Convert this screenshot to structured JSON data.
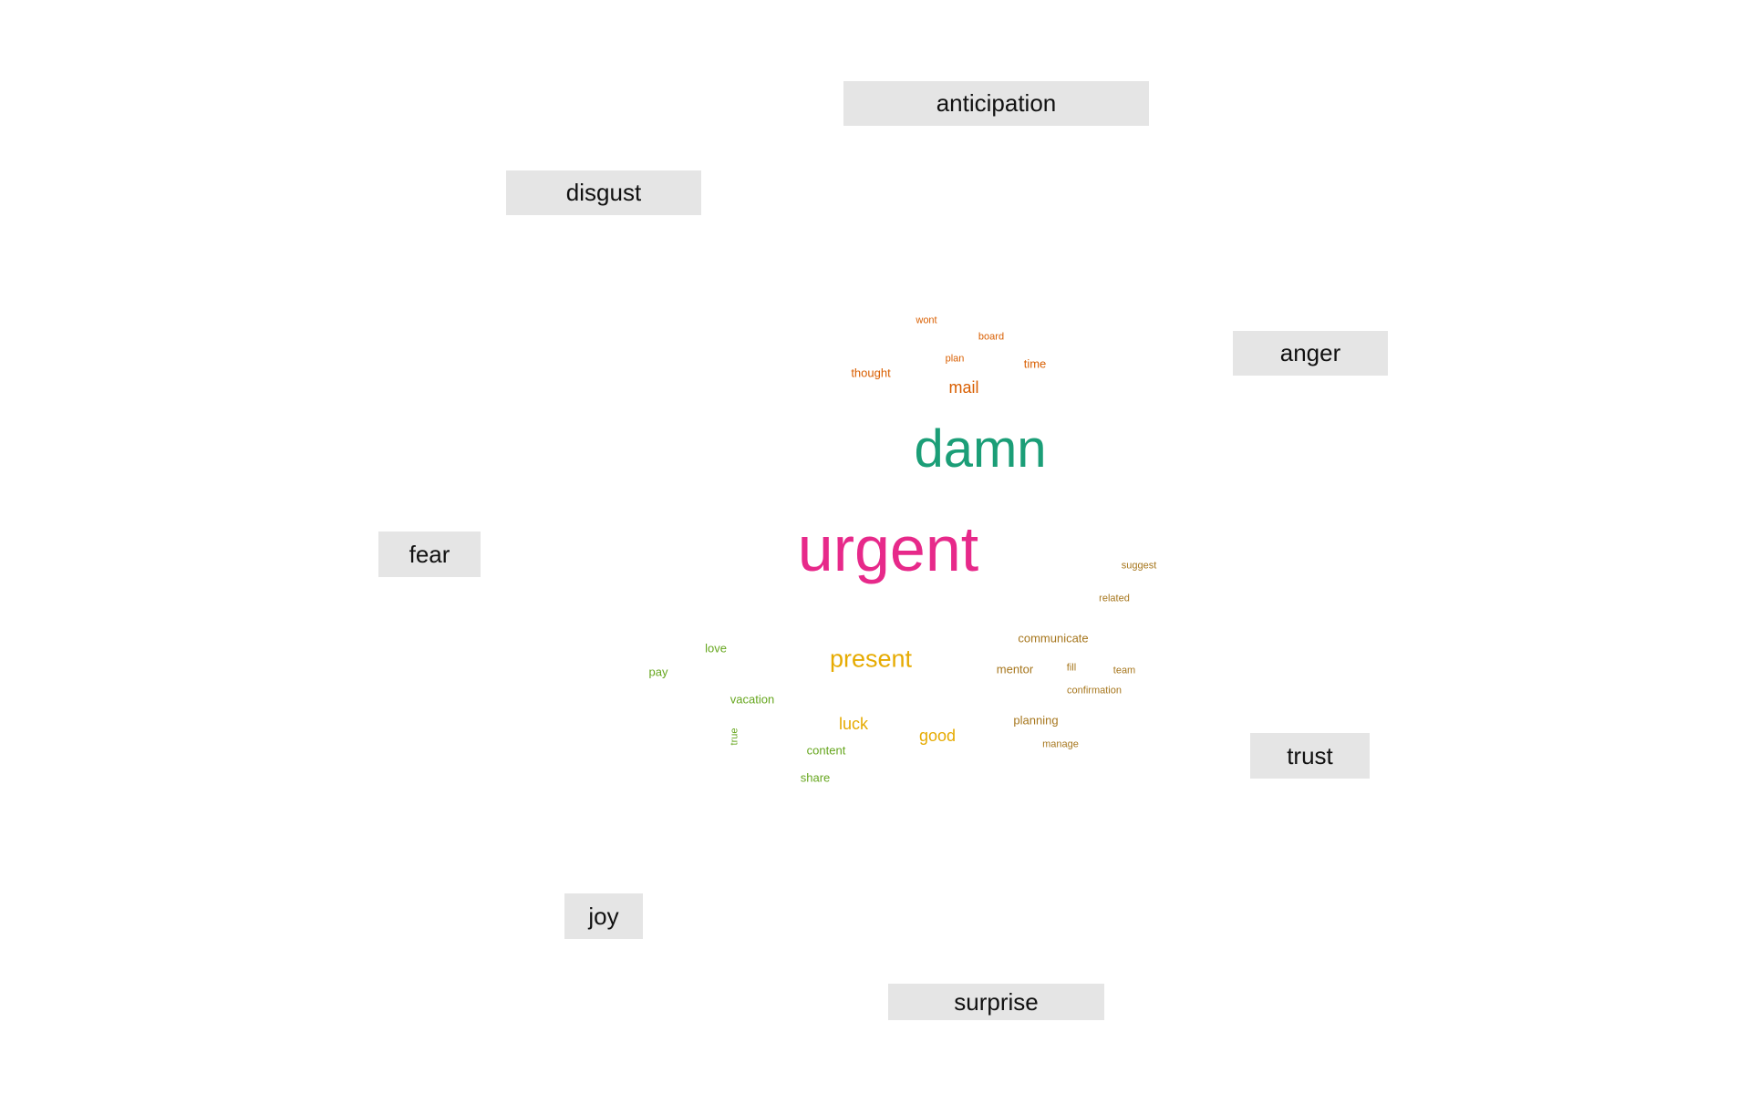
{
  "chart_data": {
    "type": "comparison-wordcloud",
    "categories": [
      "anticipation",
      "disgust",
      "anger",
      "fear",
      "trust",
      "joy",
      "surprise"
    ],
    "groups": [
      {
        "category": "anger",
        "color": "#d95f02",
        "words": [
          {
            "text": "wont",
            "weight": 1
          },
          {
            "text": "board",
            "weight": 1
          },
          {
            "text": "plan",
            "weight": 1
          },
          {
            "text": "thought",
            "weight": 2
          },
          {
            "text": "time",
            "weight": 2
          },
          {
            "text": "mail",
            "weight": 3
          }
        ]
      },
      {
        "category": "disgust",
        "color": "#1b9e77",
        "words": [
          {
            "text": "damn",
            "weight": 10
          }
        ]
      },
      {
        "category": "fear",
        "color": "#e7298a",
        "words": [
          {
            "text": "urgent",
            "weight": 12
          }
        ]
      },
      {
        "category": "surprise",
        "color": "#e6ab02",
        "words": [
          {
            "text": "present",
            "weight": 4
          },
          {
            "text": "luck",
            "weight": 3
          },
          {
            "text": "good",
            "weight": 3
          }
        ]
      },
      {
        "category": "joy",
        "color": "#66a61e",
        "words": [
          {
            "text": "love",
            "weight": 2
          },
          {
            "text": "pay",
            "weight": 2
          },
          {
            "text": "vacation",
            "weight": 2
          },
          {
            "text": "true",
            "weight": 1,
            "vertical": true
          },
          {
            "text": "content",
            "weight": 2
          },
          {
            "text": "share",
            "weight": 2
          }
        ]
      },
      {
        "category": "trust",
        "color": "#a6761d",
        "words": [
          {
            "text": "suggest",
            "weight": 1
          },
          {
            "text": "related",
            "weight": 1
          },
          {
            "text": "communicate",
            "weight": 2
          },
          {
            "text": "mentor",
            "weight": 2
          },
          {
            "text": "fill",
            "weight": 1
          },
          {
            "text": "team",
            "weight": 1
          },
          {
            "text": "confirmation",
            "weight": 1
          },
          {
            "text": "planning",
            "weight": 2
          },
          {
            "text": "manage",
            "weight": 1
          }
        ]
      }
    ]
  }
}
